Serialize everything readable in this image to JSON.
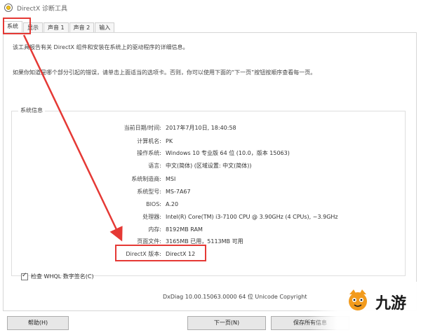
{
  "window": {
    "title": "DirectX 诊断工具"
  },
  "tabs": [
    {
      "label": "系统",
      "active": true
    },
    {
      "label": "显示",
      "active": false
    },
    {
      "label": "声音 1",
      "active": false
    },
    {
      "label": "声音 2",
      "active": false
    },
    {
      "label": "输入",
      "active": false
    }
  ],
  "description": {
    "line1": "该工具报告有关 DirectX 组件和安装在系统上的驱动程序的详细信息。",
    "line2": "如果你知道是哪个部分引起的错误，请单击上面适当的选项卡。否则，你可以使用下面的“下一页”按钮按顺序查看每一页。"
  },
  "system_info": {
    "group_title": "系统信息",
    "rows": [
      {
        "label": "当前日期/时间:",
        "value": "2017年7月10日, 18:40:58"
      },
      {
        "label": "计算机名:",
        "value": "PK"
      },
      {
        "label": "操作系统:",
        "value": "Windows 10 专业版 64 位 (10.0，版本 15063)"
      },
      {
        "label": "语言:",
        "value": "中文(简体) (区域设置: 中文(简体))"
      },
      {
        "label": "系统制造商:",
        "value": "MSI"
      },
      {
        "label": "系统型号:",
        "value": "MS-7A67"
      },
      {
        "label": "BIOS:",
        "value": "A.20"
      },
      {
        "label": "处理器:",
        "value": "Intel(R) Core(TM) i3-7100 CPU @ 3.90GHz (4 CPUs), ~3.9GHz"
      },
      {
        "label": "内存:",
        "value": "8192MB RAM"
      },
      {
        "label": "页面文件:",
        "value": "3165MB 已用，5113MB 可用"
      },
      {
        "label": "DirectX 版本:",
        "value": "DirectX 12"
      }
    ]
  },
  "whql": {
    "label": "检查 WHQL 数字签名(C)",
    "checked": true
  },
  "footer": {
    "dxdiag_version": "DxDiag 10.00.15063.0000 64 位 Unicode  Copyright"
  },
  "buttons": {
    "help": "帮助(H)",
    "next": "下一页(N)",
    "save": "保存所有信息"
  },
  "watermark": {
    "text": "九游"
  },
  "annotation_color": "#e53935"
}
